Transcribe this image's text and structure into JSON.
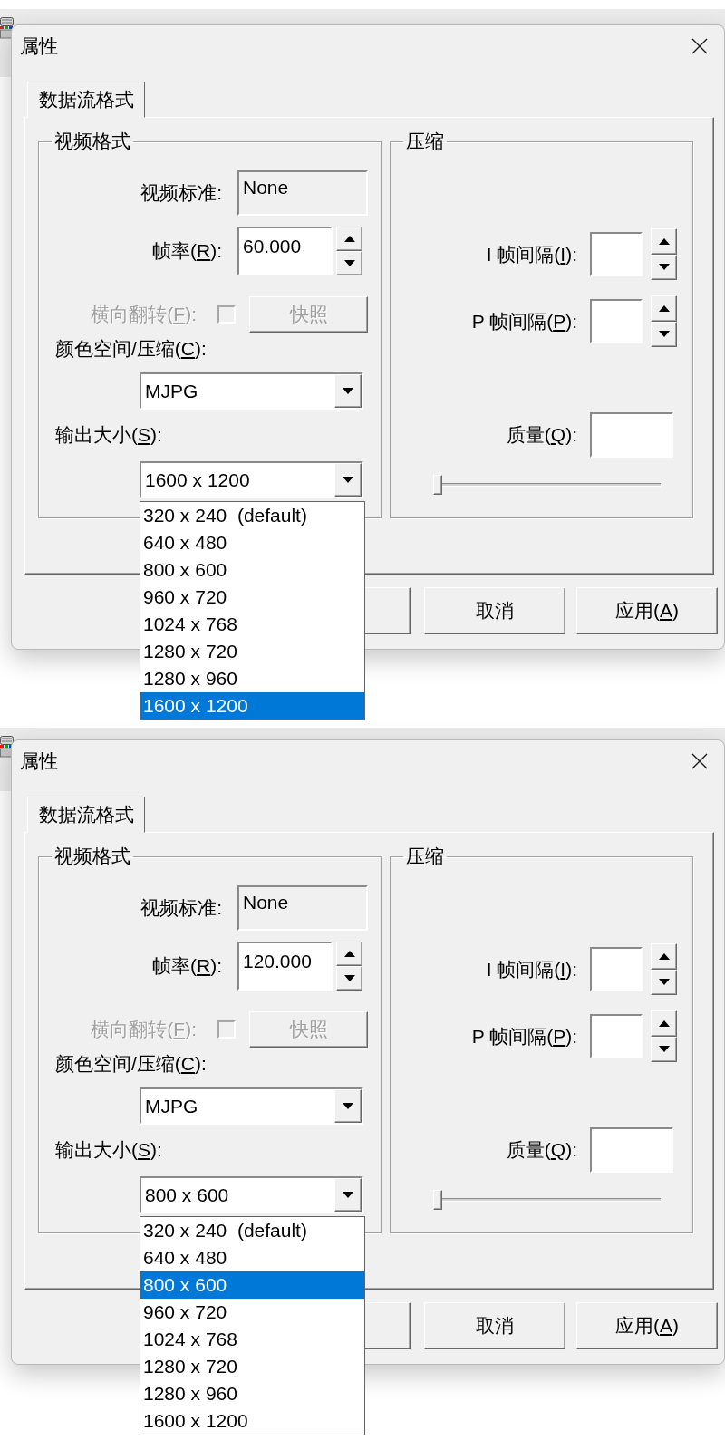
{
  "dialogs": [
    {
      "title": "属性",
      "tabs": [
        {
          "label": "数据流格式",
          "selected": true
        }
      ],
      "video_format": {
        "title": "视频格式",
        "video_standard": {
          "label": {
            "text": "视频标准:"
          },
          "value": "None",
          "read_only": true
        },
        "frame_rate": {
          "label": {
            "text": "帧率(",
            "key": "R",
            "tail": "):"
          },
          "value": "60.000"
        },
        "flip_horizontal": {
          "label": {
            "text": "横向翻转(",
            "key": "F",
            "tail": "):"
          },
          "checked": false,
          "disabled": true
        },
        "snapshot_button": {
          "label": "快照",
          "disabled": true
        },
        "color_space": {
          "label": {
            "text": "颜色空间/压缩(",
            "key": "C",
            "tail": "):"
          },
          "value": "MJPG"
        },
        "output_size": {
          "label": {
            "text": "输出大小(",
            "key": "S",
            "tail": "):"
          },
          "value": "1600 x 1200",
          "expanded": true,
          "options": [
            {
              "label": "320 x 240  (default)",
              "selected": false
            },
            {
              "label": "640 x 480",
              "selected": false
            },
            {
              "label": "800 x 600",
              "selected": false
            },
            {
              "label": "960 x 720",
              "selected": false
            },
            {
              "label": "1024 x 768",
              "selected": false
            },
            {
              "label": "1280 x 720",
              "selected": false
            },
            {
              "label": "1280 x 960",
              "selected": false
            },
            {
              "label": "1600 x 1200",
              "selected": true
            }
          ]
        }
      },
      "compression": {
        "title": "压缩",
        "i_frame_interval": {
          "label": {
            "text": "I 帧间隔(",
            "key": "I",
            "tail": "):"
          }
        },
        "p_frame_interval": {
          "label": {
            "text": "P 帧间隔(",
            "key": "P",
            "tail": "):"
          }
        },
        "quality": {
          "label": {
            "text": "质量(",
            "key": "Q",
            "tail": "):"
          },
          "level": 0
        }
      },
      "buttons": [
        {
          "kind": "covered"
        },
        {
          "kind": "text",
          "label": {
            "text": "取消"
          }
        },
        {
          "kind": "text",
          "label": {
            "text": "应用(",
            "key": "A",
            "tail": ")"
          }
        }
      ]
    },
    {
      "title": "属性",
      "tabs": [
        {
          "label": "数据流格式",
          "selected": true
        }
      ],
      "video_format": {
        "title": "视频格式",
        "video_standard": {
          "label": {
            "text": "视频标准:"
          },
          "value": "None",
          "read_only": true
        },
        "frame_rate": {
          "label": {
            "text": "帧率(",
            "key": "R",
            "tail": "):"
          },
          "value": "120.000"
        },
        "flip_horizontal": {
          "label": {
            "text": "横向翻转(",
            "key": "F",
            "tail": "):"
          },
          "checked": false,
          "disabled": true
        },
        "snapshot_button": {
          "label": "快照",
          "disabled": true
        },
        "color_space": {
          "label": {
            "text": "颜色空间/压缩(",
            "key": "C",
            "tail": "):"
          },
          "value": "MJPG"
        },
        "output_size": {
          "label": {
            "text": "输出大小(",
            "key": "S",
            "tail": "):"
          },
          "value": "800 x 600",
          "expanded": true,
          "options": [
            {
              "label": "320 x 240  (default)",
              "selected": false
            },
            {
              "label": "640 x 480",
              "selected": false
            },
            {
              "label": "800 x 600",
              "selected": true
            },
            {
              "label": "960 x 720",
              "selected": false
            },
            {
              "label": "1024 x 768",
              "selected": false
            },
            {
              "label": "1280 x 720",
              "selected": false
            },
            {
              "label": "1280 x 960",
              "selected": false
            },
            {
              "label": "1600 x 1200",
              "selected": false
            }
          ]
        }
      },
      "compression": {
        "title": "压缩",
        "i_frame_interval": {
          "label": {
            "text": "I 帧间隔(",
            "key": "I",
            "tail": "):"
          }
        },
        "p_frame_interval": {
          "label": {
            "text": "P 帧间隔(",
            "key": "P",
            "tail": "):"
          }
        },
        "quality": {
          "label": {
            "text": "质量(",
            "key": "Q",
            "tail": "):"
          },
          "level": 0
        }
      },
      "buttons": [
        {
          "kind": "covered"
        },
        {
          "kind": "text",
          "label": {
            "text": "取消"
          }
        },
        {
          "kind": "text",
          "label": {
            "text": "应用(",
            "key": "A",
            "tail": ")"
          }
        }
      ]
    }
  ]
}
